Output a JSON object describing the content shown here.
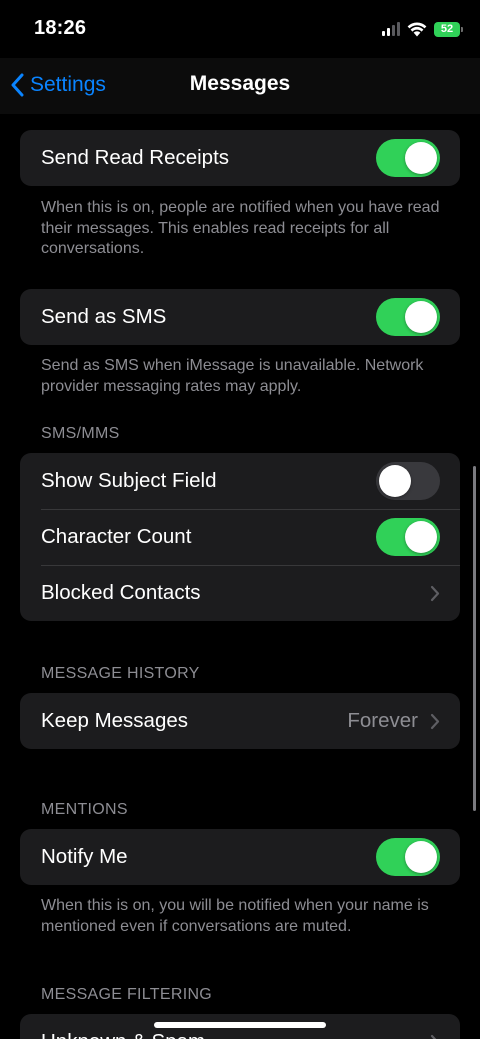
{
  "status_bar": {
    "time": "18:26",
    "battery": "52"
  },
  "nav": {
    "back_label": "Settings",
    "title": "Messages"
  },
  "groups": {
    "read_receipts": {
      "label": "Send Read Receipts",
      "on": true,
      "footer": "When this is on, people are notified when you have read their messages. This enables read receipts for all conversations."
    },
    "send_as_sms": {
      "label": "Send as SMS",
      "on": true,
      "footer": "Send as SMS when iMessage is unavailable. Network provider messaging rates may apply."
    },
    "sms_mms": {
      "header": "SMS/MMS",
      "show_subject": {
        "label": "Show Subject Field",
        "on": false
      },
      "character_count": {
        "label": "Character Count",
        "on": true
      },
      "blocked_contacts": {
        "label": "Blocked Contacts"
      }
    },
    "message_history": {
      "header": "MESSAGE HISTORY",
      "keep_messages": {
        "label": "Keep Messages",
        "value": "Forever"
      }
    },
    "mentions": {
      "header": "MENTIONS",
      "notify_me": {
        "label": "Notify Me",
        "on": true
      },
      "footer": "When this is on, you will be notified when your name is mentioned even if conversations are muted."
    },
    "message_filtering": {
      "header": "MESSAGE FILTERING",
      "unknown_spam": {
        "label": "Unknown & Spam"
      }
    }
  },
  "colors": {
    "accent": "#0a84ff",
    "toggle_on": "#30d158",
    "toggle_off": "#39393d",
    "cell_bg": "#1c1c1e",
    "secondary_text": "#8d8d93"
  },
  "icons": {
    "back": "chevron-left-icon",
    "disclosure": "chevron-right-icon",
    "signal": "cellular-signal-icon",
    "wifi": "wifi-icon",
    "battery": "battery-icon"
  }
}
